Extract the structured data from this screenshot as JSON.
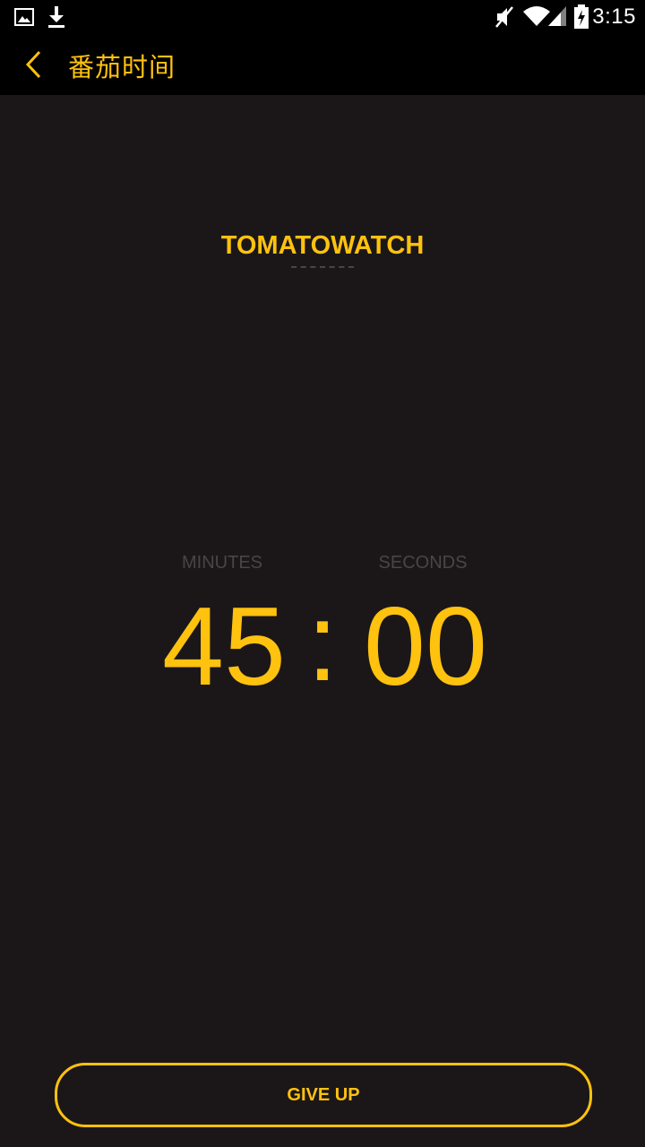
{
  "status_bar": {
    "time": "3:15",
    "icons": [
      "image-icon",
      "download-icon",
      "mute-icon",
      "wifi-icon",
      "signal-icon",
      "battery-charging-icon"
    ]
  },
  "app_bar": {
    "title": "番茄时间",
    "back_icon": "chevron-left-icon"
  },
  "brand": {
    "name": "TOMATOWATCH"
  },
  "timer": {
    "minutes_label": "MINUTES",
    "seconds_label": "SECONDS",
    "minutes": "45",
    "separator": ":",
    "seconds": "00"
  },
  "actions": {
    "give_up_label": "GIVE UP"
  },
  "colors": {
    "accent": "#ffc20e",
    "background": "#1b1719",
    "bar": "#000000",
    "muted_label": "#4a4447"
  }
}
